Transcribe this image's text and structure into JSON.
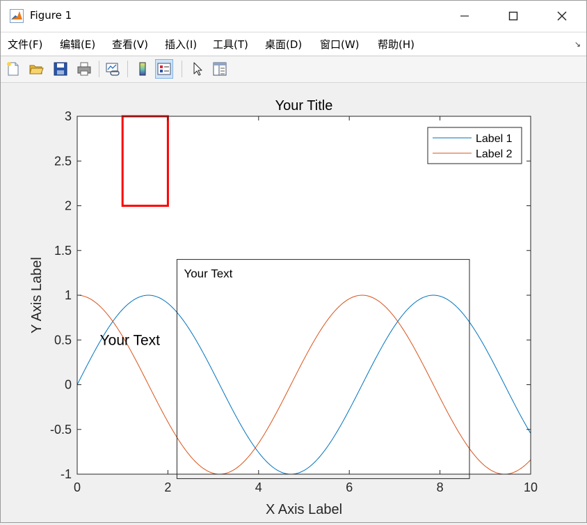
{
  "window": {
    "title": "Figure 1",
    "icons": {
      "app": "matlab-icon",
      "minimize": "minimize-icon",
      "maximize": "maximize-icon",
      "close": "close-icon"
    }
  },
  "menu": {
    "items": [
      "文件(F)",
      "编辑(E)",
      "查看(V)",
      "插入(I)",
      "工具(T)",
      "桌面(D)",
      "窗口(W)",
      "帮助(H)"
    ],
    "overflow_icon": "dock-arrow-icon"
  },
  "toolbar": {
    "buttons": [
      "new-figure-icon",
      "open-file-icon",
      "save-icon",
      "print-icon",
      "link-plot-icon",
      "insert-colorbar-icon",
      "insert-legend-icon",
      "edit-plot-icon",
      "property-inspector-icon"
    ]
  },
  "chart_data": {
    "type": "line",
    "title": "Your Title",
    "xlabel": "X Axis Label",
    "ylabel": "Y Axis Label",
    "xlim": [
      0,
      10
    ],
    "ylim": [
      -1,
      3
    ],
    "xticks": [
      "0",
      "2",
      "4",
      "6",
      "8",
      "10"
    ],
    "yticks": [
      "-1",
      "-0.5",
      "0",
      "0.5",
      "1",
      "1.5",
      "2",
      "2.5",
      "3"
    ],
    "series": [
      {
        "name": "Label 1",
        "function": "sin(x)",
        "color": "#0072bd"
      },
      {
        "name": "Label 2",
        "function": "cos(x)",
        "color": "#d95319"
      }
    ],
    "legend": {
      "placement": "top-right",
      "entries": [
        "Label 1",
        "Label 2"
      ]
    },
    "annotations": {
      "text_plain": {
        "text": "Your Text",
        "x": 0.5,
        "y": 0.5
      },
      "textbox": {
        "text": "Your Text",
        "x_range": [
          2.2,
          8.65
        ],
        "y_range": [
          -1.05,
          1.4
        ]
      },
      "rectangle": {
        "x_range": [
          1,
          2
        ],
        "y_range": [
          2,
          3
        ],
        "color": "#ff0000"
      }
    }
  }
}
